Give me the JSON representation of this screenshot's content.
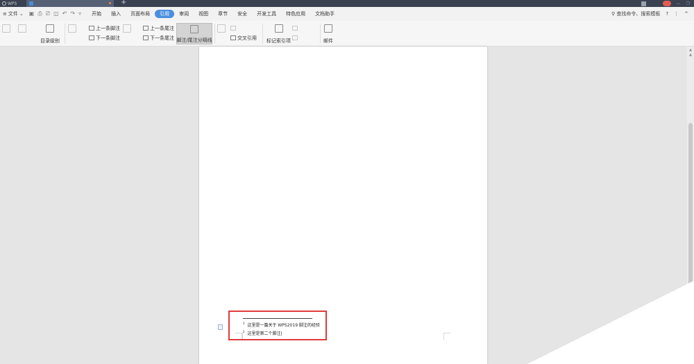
{
  "titlebar": {
    "app_tab": "WPS",
    "doc_tab": "",
    "new_tab": "+",
    "right_items": [
      "",
      ""
    ],
    "login": ""
  },
  "menubar": {
    "file": "文件",
    "tabs": [
      {
        "label": "开始",
        "active": false
      },
      {
        "label": "插入",
        "active": false
      },
      {
        "label": "页面布局",
        "active": false
      },
      {
        "label": "引用",
        "active": true
      },
      {
        "label": "审阅",
        "active": false
      },
      {
        "label": "视图",
        "active": false
      },
      {
        "label": "章节",
        "active": false
      },
      {
        "label": "安全",
        "active": false
      },
      {
        "label": "开发工具",
        "active": false
      },
      {
        "label": "特色应用",
        "active": false
      },
      {
        "label": "文档助手",
        "active": false
      }
    ],
    "search": "查找命令、搜索模板",
    "help": "?"
  },
  "ribbon": {
    "toc": "",
    "update_toc": "",
    "toc_level": "目录级别",
    "insert_footnote": "",
    "prev_footnote": "上一条脚注",
    "next_footnote": "下一条脚注",
    "insert_endnote": "",
    "prev_endnote": "上一条尾注",
    "next_endnote": "下一条尾注",
    "footnote_separator": "脚注/尾注分隔线",
    "caption": "",
    "insert_table_of_figures": "",
    "cross_reference": "交叉引用",
    "mark_index_entry": "标记索引项",
    "insert_index": "",
    "update_index": "",
    "mail": "邮件"
  },
  "document": {
    "footnotes": [
      {
        "mark": "1",
        "text": "这里是一篇关于 WPS2019 脚注的经验"
      },
      {
        "mark": "2",
        "text": "这里是第二个脚注"
      }
    ]
  },
  "colors": {
    "accent": "#4b8ee0",
    "highlight_box": "#e03a3a",
    "titlebar": "#3a4150"
  }
}
